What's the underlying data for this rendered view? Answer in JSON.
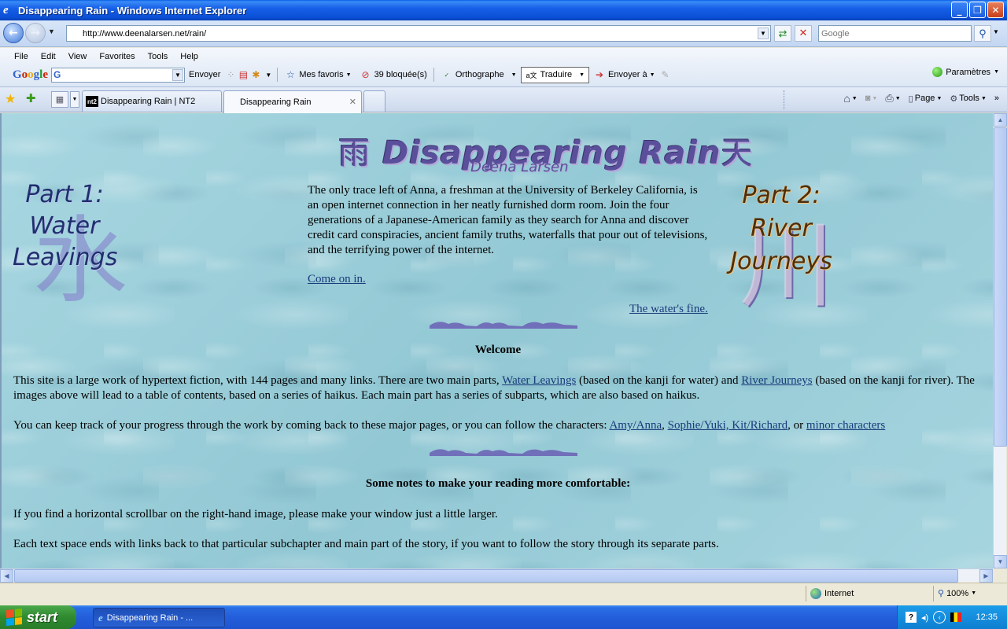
{
  "window": {
    "title": "Disappearing Rain - Windows Internet Explorer",
    "minimize": "_",
    "maximize": "❐",
    "close": "✕"
  },
  "address": {
    "url": "http://www.deenalarsen.net/rain/",
    "search_placeholder": "Google"
  },
  "menubar": [
    "File",
    "Edit",
    "View",
    "Favorites",
    "Tools",
    "Help"
  ],
  "google_toolbar": {
    "logo": [
      "G",
      "o",
      "o",
      "g",
      "l",
      "e"
    ],
    "search_g": "G",
    "send_label": "Envoyer",
    "favorites_label": "Mes favoris",
    "blocked_label": "39 bloquée(s)",
    "spell_label": "Orthographe",
    "translate_label": "Traduire",
    "send_to_label": "Envoyer à",
    "settings_label": "Paramètres"
  },
  "tabs": [
    {
      "label": "Disappearing Rain | NT2",
      "icon_text": "nt2",
      "active": false
    },
    {
      "label": "Disappearing Rain",
      "active": true
    }
  ],
  "commandbar": {
    "page_label": "Page",
    "tools_label": "Tools"
  },
  "page": {
    "title_kanji_left": "雨",
    "title": "Disappearing Rain",
    "title_kanji_right": "天",
    "author": "Deena Larsen",
    "part1": {
      "lines": [
        "Part 1:",
        "Water",
        "Leavings"
      ],
      "kanji": "水"
    },
    "part2": {
      "lines": [
        "Part 2:",
        "River",
        "Journeys"
      ],
      "kanji": "川"
    },
    "intro": "The only trace left of Anna, a freshman at the University of Berkeley California, is an open internet connection in her neatly furnished dorm room. Join the four generations of a Japanese-American family as they search for Anna and discover credit card conspiracies, ancient family truths, waterfalls that pour out of televisions, and the terrifying power of the internet.",
    "come_in": "Come on in.",
    "waters_fine": "The water's fine.",
    "welcome": "Welcome",
    "p1": {
      "t1": "This site is a large work of hypertext fiction, with 144 pages and many links. There are two main parts, ",
      "link1": "Water Leavings",
      "t2": " (based on the kanji for water) and ",
      "link2": "River Journeys",
      "t3": " (based on the kanji for river). The images above will lead to a table of contents, based on a series of haikus. Each main part has a series of subparts, which are also based on haikus."
    },
    "p2": {
      "t1": "You can keep track of your progress through the work by coming back to these major pages, or you can follow the characters: ",
      "link1": "Amy/Anna",
      "t2": ", ",
      "link2": "Sophie/Yuki, Kit/Richard",
      "t3": ", or ",
      "link3": "minor characters"
    },
    "notes_heading": "Some notes to make your reading more comfortable:",
    "p3": "If you find a horizontal scrollbar on the right-hand image, please make your window just a little larger.",
    "p4": "Each text space ends with links back to that particular subchapter and main part of the story, if you want to follow the story through its separate parts."
  },
  "status": {
    "zone": "Internet",
    "zoom": "100%"
  },
  "taskbar": {
    "start": "start",
    "task_label": "Disappearing Rain - ...",
    "clock": "12:35"
  }
}
